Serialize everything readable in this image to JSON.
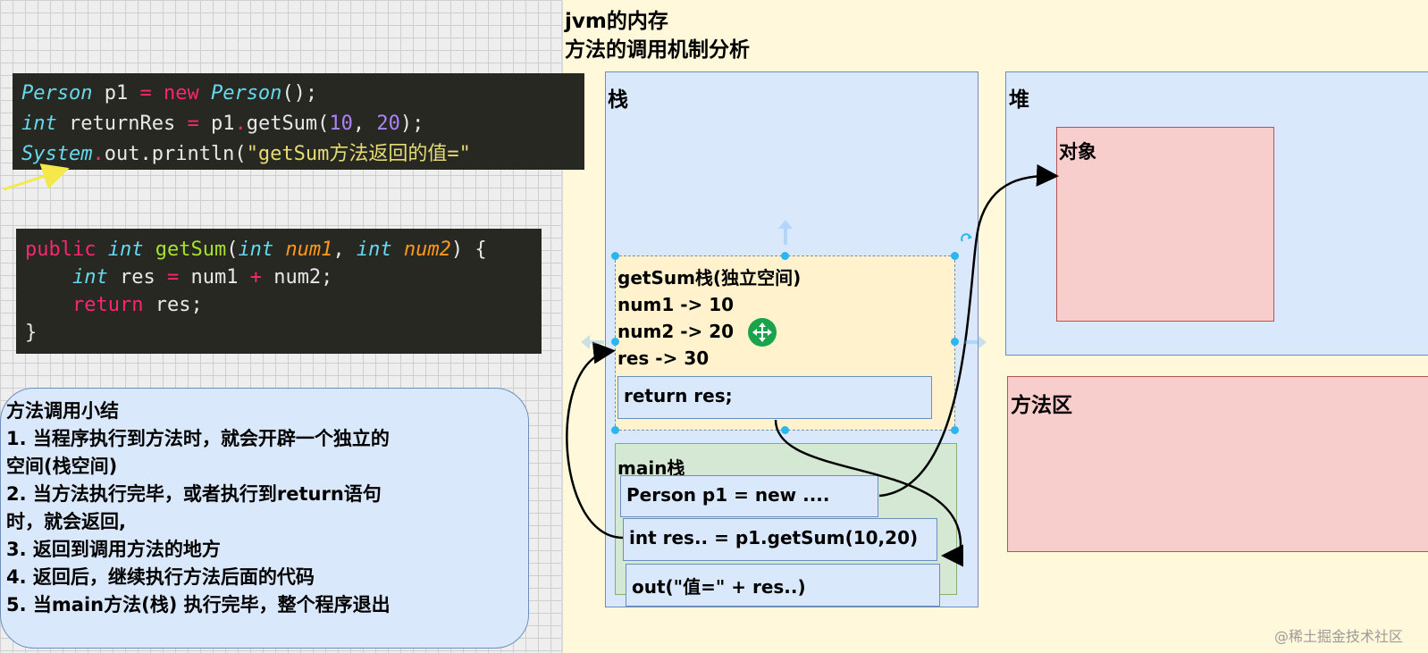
{
  "code_top": {
    "line1": {
      "type": "Person",
      "var": " p1 ",
      "eq": "=",
      "kw": " new ",
      "cls": "Person",
      "rest": "();"
    },
    "line2": {
      "type": "int",
      "var": " returnRes ",
      "eq": "=",
      "obj": " p1",
      "dot": ".",
      "call": "getSum(",
      "n1": "10",
      ", ": ", ",
      "n2": "20",
      "end": ");"
    },
    "line3": {
      "cls": "System",
      "dot": ".",
      "mid": "out.println(",
      "str": "\"getSum方法返回的值=\""
    }
  },
  "code_method": {
    "l1_kw": "public",
    "l1_ty": " int",
    "l1_fn": " getSum",
    "l1_a": "(",
    "l1_t1": "int",
    "l1_p1": " num1",
    "l1_c": ", ",
    "l1_t2": "int",
    "l1_p2": " num2",
    "l1_b": ") {",
    "l2_ty": "int",
    "l2_rest": " res ",
    "l2_eq": "=",
    "l2_a": " num1 ",
    "l2_plus": "+",
    "l2_b": " num2;",
    "l3_kw": "return",
    "l3_rest": " res;",
    "l4": "}"
  },
  "summary": {
    "title": "方法调用小结",
    "items": [
      "1. 当程序执行到方法时，就会开辟一个独立的",
      "空间(栈空间)",
      "2. 当方法执行完毕，或者执行到return语句",
      "时，就会返回,",
      "3. 返回到调用方法的地方",
      "4. 返回后，继续执行方法后面的代码",
      "5. 当main方法(栈) 执行完毕，整个程序退出"
    ]
  },
  "titles": {
    "t1": "jvm的内存",
    "t2": "方法的调用机制分析"
  },
  "areas": {
    "stack": "栈",
    "heap": "堆",
    "object": "对象",
    "method_area": "方法区"
  },
  "getsum_frame": {
    "lines": [
      "getSum栈(独立空间)",
      "num1 -> 10",
      "num2 -> 20",
      "res -> 30"
    ],
    "return_row": "return res;"
  },
  "main_frame": {
    "label": "main栈",
    "rows": [
      "Person p1 = new ....",
      "int res.. = p1.getSum(10,20)",
      "out(\"值=\" + res..)"
    ]
  },
  "watermark": "@稀土掘金技术社区",
  "colors": {
    "stack_fill": "#dae8fc",
    "object_fill": "#f8cecc",
    "frame_fill": "#fff2cc",
    "main_fill": "#d5e8d4",
    "canvas": "#fff8da",
    "code_bg": "#272822",
    "handle": "#29b6f2",
    "move_icon": "#1aa34a"
  },
  "icons": {
    "move": "move-cursor-icon",
    "rotate": "rotate-handle-icon",
    "arrow": "pointer-arrow-icon"
  }
}
